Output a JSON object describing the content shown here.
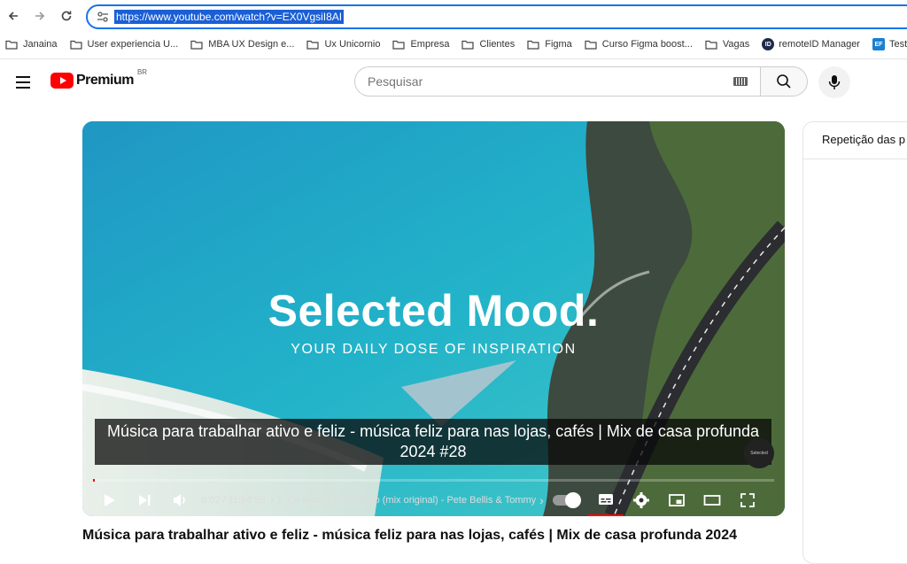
{
  "browser": {
    "url": "https://www.youtube.com/watch?v=EX0VgsiI8AI",
    "bookmarks": [
      {
        "label": "Janaina",
        "type": "folder"
      },
      {
        "label": "User experiencia U...",
        "type": "folder"
      },
      {
        "label": "MBA UX Design e...",
        "type": "folder"
      },
      {
        "label": "Ux Unicornio",
        "type": "folder"
      },
      {
        "label": "Empresa",
        "type": "folder"
      },
      {
        "label": "Clientes",
        "type": "folder"
      },
      {
        "label": "Figma",
        "type": "folder"
      },
      {
        "label": "Curso Figma boost...",
        "type": "folder"
      },
      {
        "label": "Vagas",
        "type": "folder"
      },
      {
        "label": "remoteID Manager",
        "type": "site"
      },
      {
        "label": "Teste de inglês",
        "type": "site"
      }
    ]
  },
  "youtube": {
    "logo_text": "Premium",
    "country_code": "BR",
    "search_placeholder": "Pesquisar"
  },
  "player": {
    "overlay_title": "Selected Mood.",
    "overlay_subtitle": "YOUR DAILY DOSE OF INSPIRATION",
    "caption": "Música para trabalhar ativo e feliz - música feliz para nas lojas, cafés | Mix de casa profunda 2024 #28",
    "channel_badge": "Selected",
    "current_time": "0:02",
    "duration": "11:54:58",
    "time_display": "0:02 / 11:54:58",
    "chapter": "• 1. Eu estava te amando (mix original) - Pete Bellis & Tommy",
    "chapter_arrow": "›",
    "progress_fraction": 0.001
  },
  "video": {
    "title": "Música para trabalhar ativo e feliz - música feliz para nas lojas, cafés | Mix de casa profunda 2024"
  },
  "side_panel": {
    "header": "Repetição das p"
  },
  "colors": {
    "accent_blue": "#1a73e8",
    "url_highlight": "#1a5fd6",
    "youtube_red": "#ff0000"
  }
}
